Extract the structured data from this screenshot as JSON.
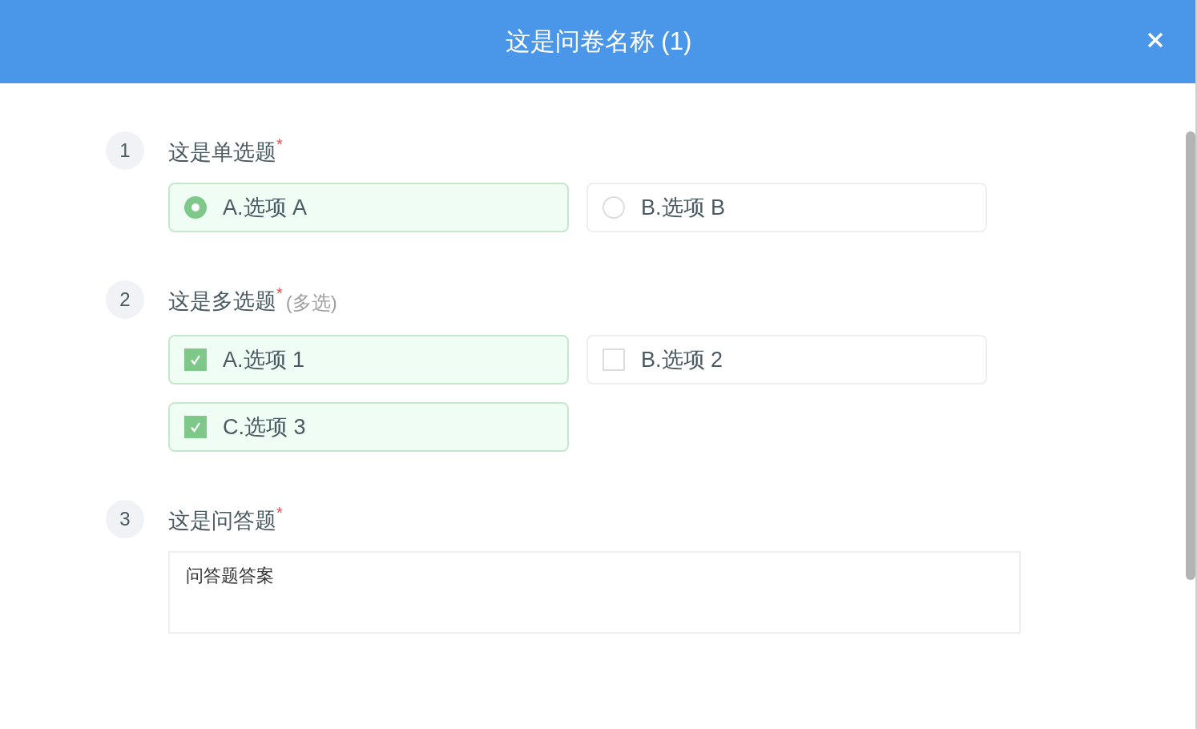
{
  "dialog": {
    "title": "这是问卷名称 (1)"
  },
  "questions": [
    {
      "kind": "single",
      "number": "1",
      "title": "这是单选题",
      "required_mark": "*",
      "options": [
        {
          "label": "A.选项 A",
          "selected": true
        },
        {
          "label": "B.选项 B",
          "selected": false
        }
      ]
    },
    {
      "kind": "multi",
      "number": "2",
      "title": "这是多选题",
      "required_mark": "*",
      "hint": "(多选)",
      "options": [
        {
          "label": "A.选项 1",
          "checked": true
        },
        {
          "label": "B.选项 2",
          "checked": false
        },
        {
          "label": "C.选项 3",
          "checked": true
        }
      ]
    },
    {
      "kind": "text",
      "number": "3",
      "title": "这是问答题",
      "required_mark": "*",
      "answer": "问答题答案"
    }
  ]
}
